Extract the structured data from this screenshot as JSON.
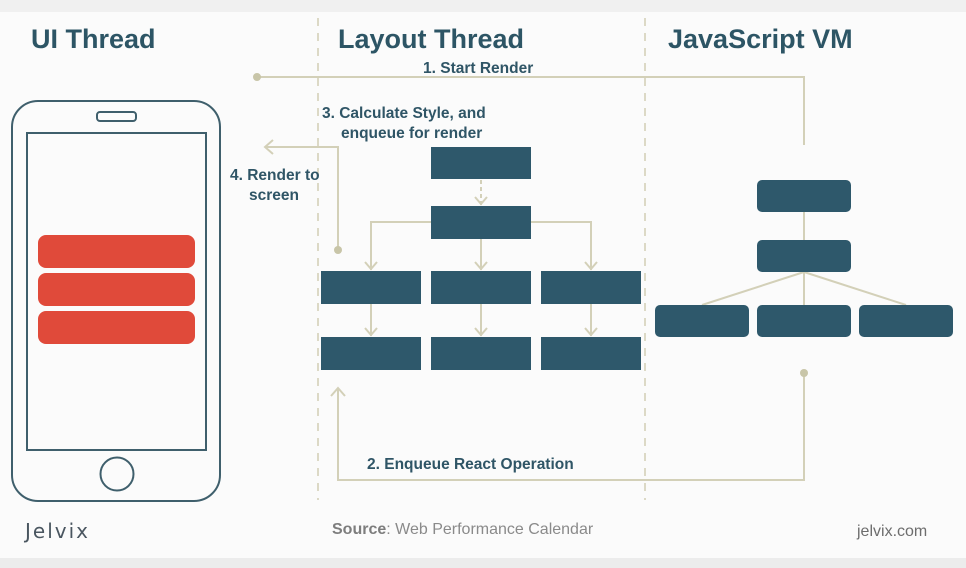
{
  "headings": {
    "ui_thread": "UI Thread",
    "layout_thread": "Layout Thread",
    "javascript_vm": "JavaScript VM"
  },
  "steps": {
    "step1": "1. Start Render",
    "step2": "2. Enqueue React Operation",
    "step3_line1": "3. Calculate Style, and",
    "step3_line2": "enqueue for render",
    "step4_line1": "4. Render to",
    "step4_line2": "screen"
  },
  "footer": {
    "brand": "Jelvix",
    "source_label": "Source",
    "source_value": ": Web Performance Calendar",
    "website": "jelvix.com"
  },
  "colors": {
    "node": "#2e586b",
    "phone_bar": "#e04a3a",
    "connector": "#d3d0b8",
    "divider": "#dcd9c6",
    "heading": "#2d5565"
  }
}
